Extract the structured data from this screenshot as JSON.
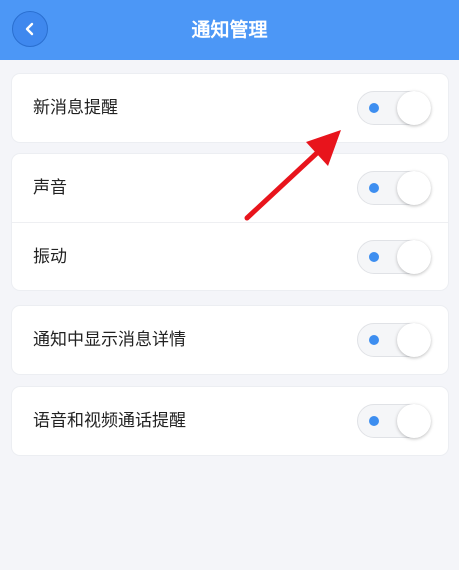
{
  "header": {
    "title": "通知管理",
    "back_icon": "chevron-left-icon",
    "color": "#4c97f6"
  },
  "groups": [
    {
      "items": [
        {
          "label": "新消息提醒",
          "enabled": false
        }
      ]
    },
    {
      "items": [
        {
          "label": "声音",
          "enabled": false
        },
        {
          "label": "振动",
          "enabled": false
        }
      ]
    },
    {
      "items": [
        {
          "label": "通知中显示消息详情",
          "enabled": false
        }
      ]
    },
    {
      "items": [
        {
          "label": "语音和视频通话提醒",
          "enabled": false
        }
      ]
    }
  ],
  "annotation": {
    "type": "red-arrow",
    "color": "#e8141c",
    "points_to": "新消息提醒 toggle"
  }
}
